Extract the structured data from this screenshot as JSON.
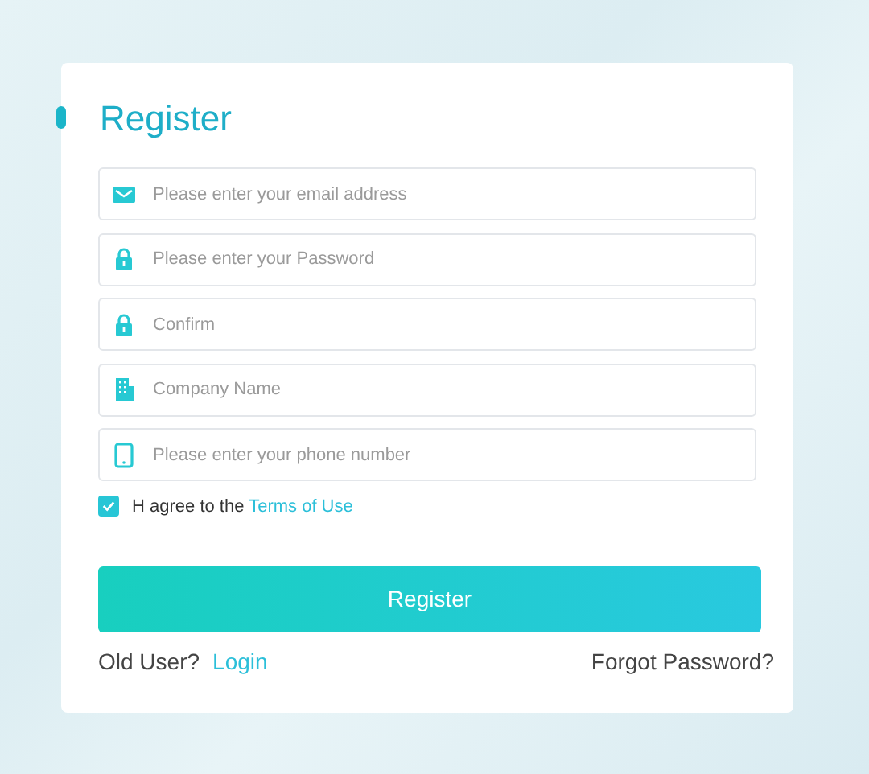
{
  "title": "Register",
  "fields": [
    {
      "kind": "email",
      "placeholder": "Please enter your email address"
    },
    {
      "kind": "lock",
      "placeholder": "Please enter your Password"
    },
    {
      "kind": "lock",
      "placeholder": "Confirm"
    },
    {
      "kind": "building",
      "placeholder": "Company Name"
    },
    {
      "kind": "phone",
      "placeholder": "Please enter your phone number"
    }
  ],
  "agreement": {
    "checked": true,
    "text": "H agree to the",
    "link": "Terms of Use"
  },
  "submit": "Register",
  "old_user": {
    "text": "Old User?",
    "link": "Login"
  },
  "forgot": "Forgot Password?"
}
